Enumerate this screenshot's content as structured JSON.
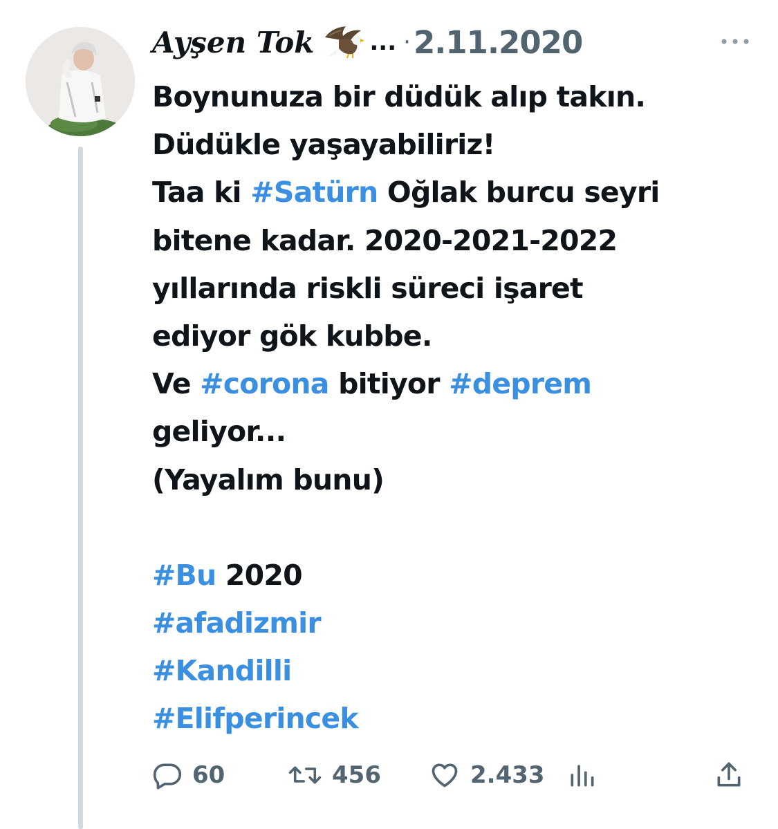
{
  "author": {
    "name": "Ayşen Tok",
    "name_suffix": "...",
    "separator": "·",
    "date": "2.11.2020"
  },
  "tweet": {
    "lines": [
      [
        {
          "text": "Boynunuza bir düdük alıp takın."
        }
      ],
      [
        {
          "text": "Düdükle yaşayabiliriz!"
        }
      ],
      [
        {
          "text": "Taa ki "
        },
        {
          "text": "#Satürn",
          "tag": true
        },
        {
          "text": " Oğlak burcu seyri"
        }
      ],
      [
        {
          "text": "bitene kadar. 2020-2021-2022"
        }
      ],
      [
        {
          "text": "yıllarında riskli süreci işaret"
        }
      ],
      [
        {
          "text": "ediyor gök kubbe."
        }
      ],
      [
        {
          "text": "Ve "
        },
        {
          "text": "#corona",
          "tag": true
        },
        {
          "text": " bitiyor "
        },
        {
          "text": "#deprem",
          "tag": true
        }
      ],
      [
        {
          "text": "geliyor..."
        }
      ],
      [
        {
          "text": "(Yayalım bunu)"
        }
      ],
      [],
      [
        {
          "text": "#Bu",
          "tag": true
        },
        {
          "text": " 2020"
        }
      ],
      [
        {
          "text": "#afadizmir",
          "tag": true
        }
      ],
      [
        {
          "text": "#Kandilli",
          "tag": true
        }
      ],
      [
        {
          "text": "#Elifperincek",
          "tag": true
        }
      ]
    ]
  },
  "actions": {
    "replies": "60",
    "retweets": "456",
    "likes": "2.433"
  },
  "icons": {
    "reply": "reply-icon",
    "retweet": "retweet-icon",
    "like": "heart-icon",
    "views": "analytics-icon",
    "share": "share-icon",
    "more": "more-icon",
    "eagle": "eagle-emoji-icon"
  },
  "colors": {
    "text": "#0f1419",
    "secondary": "#536471",
    "hashtag": "#3b8fe0",
    "thread_line": "#cfd9de"
  }
}
